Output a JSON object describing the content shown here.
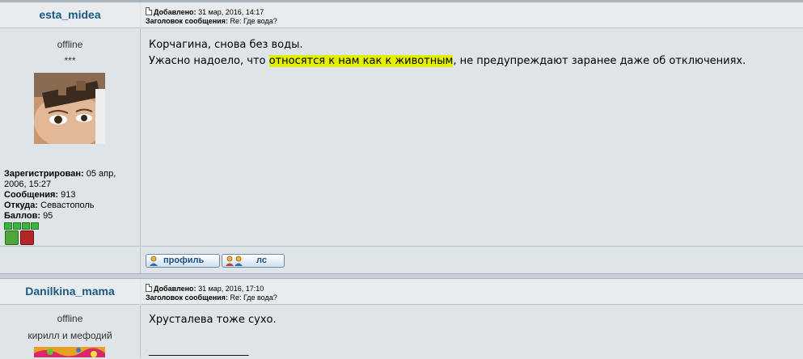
{
  "posts": [
    {
      "author": "esta_midea",
      "added_label": "Добавлено:",
      "added_date": "31 мар, 2016, 14:17",
      "subject_label": "Заголовок сообщения:",
      "subject": "Re: Где вода?",
      "status": "offline",
      "rank": "***",
      "registered_label": "Зарегистрирован:",
      "registered_value": "05 апр, 2006, 15:27",
      "messages_label": "Сообщения:",
      "messages_value": "913",
      "from_label": "Откуда:",
      "from_value": "Севастополь",
      "points_label": "Баллов:",
      "points_value": "95",
      "message_line1": "Корчагина, снова без воды.",
      "message_line2_pre": "Ужасно надоело, что ",
      "message_line2_hl": "относятся к нам как к животным",
      "message_line2_post": ", не предупреждают заранее даже об отключениях.",
      "profile_btn": "профиль",
      "pm_btn": "лс"
    },
    {
      "author": "Danilkina_mama",
      "added_label": "Добавлено:",
      "added_date": "31 мар, 2016, 17:10",
      "subject_label": "Заголовок сообщения:",
      "subject": "Re: Где вода?",
      "status": "offline",
      "rank": "кирилл и мефодий",
      "message_line1": "Хрусталева тоже сухо.",
      "signature_line": "___________________"
    }
  ]
}
